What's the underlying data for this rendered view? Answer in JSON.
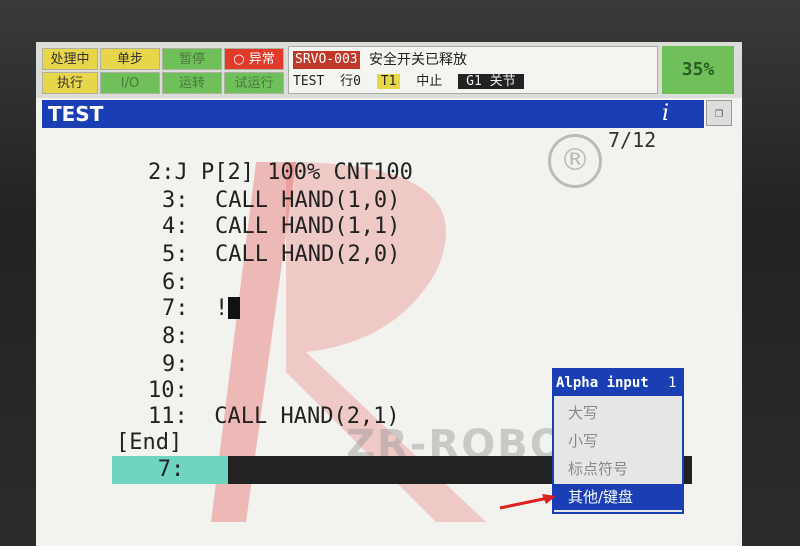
{
  "status": {
    "indicators": [
      {
        "label": "处理中",
        "style": "y"
      },
      {
        "label": "单步",
        "style": "y"
      },
      {
        "label": "暂停",
        "style": "g"
      },
      {
        "label": "异常",
        "style": "r"
      },
      {
        "label": "执行",
        "style": "y"
      },
      {
        "label": "I/O",
        "style": "g"
      },
      {
        "label": "运转",
        "style": "g"
      },
      {
        "label": "试运行",
        "style": "g"
      }
    ],
    "alarm_code": "SRVO-003",
    "alarm_message": "安全开关已释放",
    "program": "TEST",
    "line_label": "行0",
    "mode": "T1",
    "state": "中止",
    "group": "G1 关节",
    "override": "35%"
  },
  "title": "TEST",
  "line_count": "7/12",
  "registered_mark": "®",
  "program_lines": [
    {
      "num": "2:J",
      "text": " P[2] 100% CNT100"
    },
    {
      "num": "3:",
      "text": "  CALL HAND(1,0)"
    },
    {
      "num": "4:",
      "text": "  CALL HAND(1,1)"
    },
    {
      "num": "5:",
      "text": "  CALL HAND(2,0)"
    },
    {
      "num": "6:",
      "text": ""
    },
    {
      "num": "7:",
      "text": "  !"
    },
    {
      "num": "8:",
      "text": ""
    },
    {
      "num": "9:",
      "text": ""
    },
    {
      "num": "10:",
      "text": ""
    },
    {
      "num": "11:",
      "text": "  CALL HAND(2,1)"
    }
  ],
  "end_marker": "[End]",
  "edit_line": "   7:   !",
  "watermark": "ZR-ROBOT",
  "popup": {
    "title": "Alpha input",
    "number": "1",
    "items": [
      "大写",
      "小写",
      "标点符号",
      "其他/键盘"
    ],
    "selected_index": 3
  },
  "colors": {
    "title_bar": "#1a3fb5",
    "override_bg": "#6fbf5a",
    "edit_cell": "#6fd4c0",
    "alarm_red": "#c0392b"
  }
}
